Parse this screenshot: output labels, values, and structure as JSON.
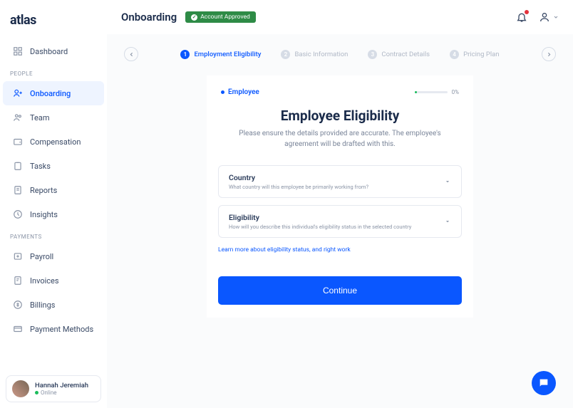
{
  "brand": "atlas",
  "page_title": "Onboarding",
  "status_badge": "Account Approved",
  "sidebar": {
    "top_item": {
      "label": "Dashboard"
    },
    "sections": [
      {
        "label": "PEOPLE",
        "items": [
          {
            "label": "Onboarding",
            "active": true
          },
          {
            "label": "Team"
          },
          {
            "label": "Compensation"
          },
          {
            "label": "Tasks"
          },
          {
            "label": "Reports"
          },
          {
            "label": "Insights"
          }
        ]
      },
      {
        "label": "PAYMENTS",
        "items": [
          {
            "label": "Payroll"
          },
          {
            "label": "Invoices"
          },
          {
            "label": "Billings"
          },
          {
            "label": "Payment Methods"
          }
        ]
      }
    ]
  },
  "user": {
    "name": "Hannah Jeremiah",
    "status": "Online"
  },
  "stepper": {
    "steps": [
      {
        "num": "1",
        "label": "Employment Eligibility",
        "active": true
      },
      {
        "num": "2",
        "label": "Basic Information"
      },
      {
        "num": "3",
        "label": "Contract Details"
      },
      {
        "num": "4",
        "label": "Pricing Plan"
      }
    ]
  },
  "card": {
    "tag": "Employee",
    "progress_pct": "0%",
    "title": "Employee Eligibility",
    "subtitle": "Please ensure the details provided are accurate. The employee's agreement will be drafted with this.",
    "fields": [
      {
        "label": "Country",
        "hint": "What country will this employee be primarily working from?"
      },
      {
        "label": "Eligibility",
        "hint": "How will you describe this individual's eligibility status in the selected country"
      }
    ],
    "link": "Learn more about eligibility status, and right work",
    "cta": "Continue"
  }
}
